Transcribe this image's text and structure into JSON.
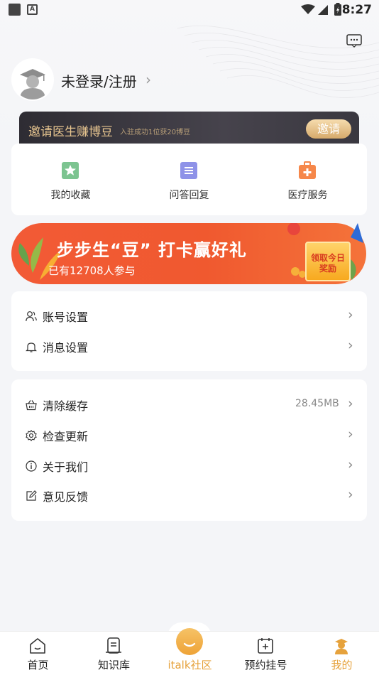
{
  "status_bar": {
    "time": "8:27"
  },
  "header": {
    "login_label": "未登录/注册",
    "chevron": "›"
  },
  "invite_banner": {
    "title": "邀请医生赚博豆",
    "subtitle": "入驻成功1位获20博豆",
    "button_label": "邀请"
  },
  "quick_actions": [
    {
      "label": "我的收藏",
      "icon": "star-icon",
      "color": "#7cc490"
    },
    {
      "label": "问答回复",
      "icon": "list-icon",
      "color": "#8e92e8"
    },
    {
      "label": "医疗服务",
      "icon": "medkit-icon",
      "color": "#f6874a"
    }
  ],
  "promo_banner": {
    "title": "步步生“豆” 打卡赢好礼",
    "participants": "已有12708人参与",
    "box_text": "领取今日奖励"
  },
  "settings_group": [
    {
      "label": "账号设置",
      "icon": "user-settings-icon"
    },
    {
      "label": "消息设置",
      "icon": "bell-icon"
    }
  ],
  "other_group": [
    {
      "label": "清除缓存",
      "icon": "basket-icon",
      "value": "28.45MB"
    },
    {
      "label": "检查更新",
      "icon": "gear-icon"
    },
    {
      "label": "关于我们",
      "icon": "info-icon"
    },
    {
      "label": "意见反馈",
      "icon": "edit-icon"
    }
  ],
  "tabs": [
    {
      "label": "首页",
      "icon": "home-icon",
      "active": false
    },
    {
      "label": "知识库",
      "icon": "book-icon",
      "active": false
    },
    {
      "label": "italk社区",
      "icon": "community-icon",
      "active": false,
      "center": true
    },
    {
      "label": "预约挂号",
      "icon": "calendar-plus-icon",
      "active": false
    },
    {
      "label": "我的",
      "icon": "profile-icon",
      "active": true
    }
  ],
  "colors": {
    "accent": "#e6a23c",
    "promo": "#f25a36",
    "invite_gold": "#e6c48f"
  }
}
